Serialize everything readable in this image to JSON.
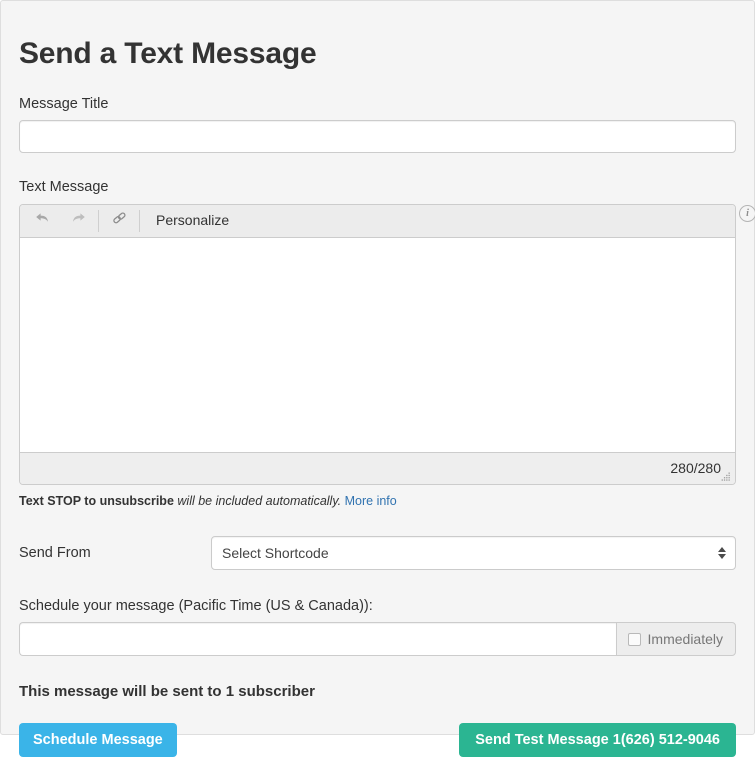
{
  "page": {
    "title": "Send a Text Message"
  },
  "message_title": {
    "label": "Message Title",
    "value": "",
    "placeholder": ""
  },
  "text_message": {
    "label": "Text Message",
    "toolbar": {
      "undo_icon": "undo-arrow-icon",
      "redo_icon": "redo-arrow-icon",
      "link_icon": "link-chain-icon",
      "personalize_label": "Personalize"
    },
    "body_value": "",
    "char_count": "280/280",
    "info_icon_glyph": "i",
    "resize_grip_icon": "resize-grip-icon"
  },
  "stop_note": {
    "bold_text": "Text STOP to unsubscribe",
    "italic_text": "will be included automatically.",
    "link_text": "More info"
  },
  "send_from": {
    "label": "Send From",
    "selected_option": "Select Shortcode",
    "options": [
      "Select Shortcode"
    ]
  },
  "schedule": {
    "label": "Schedule your message (Pacific Time (US & Canada)):",
    "value": "",
    "placeholder": "",
    "immediately_label": "Immediately",
    "immediately_checked": false
  },
  "summary": {
    "text": "This message will be sent to 1 subscriber"
  },
  "actions": {
    "schedule_button": "Schedule Message",
    "test_button": "Send Test Message 1(626) 512-9046"
  },
  "colors": {
    "page_background": "#f5f5f5",
    "schedule_button": "#3ab4e8",
    "test_button": "#2bb592",
    "link": "#3173b0",
    "toolbar_background": "#ececec",
    "status_background": "#eeeeee"
  }
}
